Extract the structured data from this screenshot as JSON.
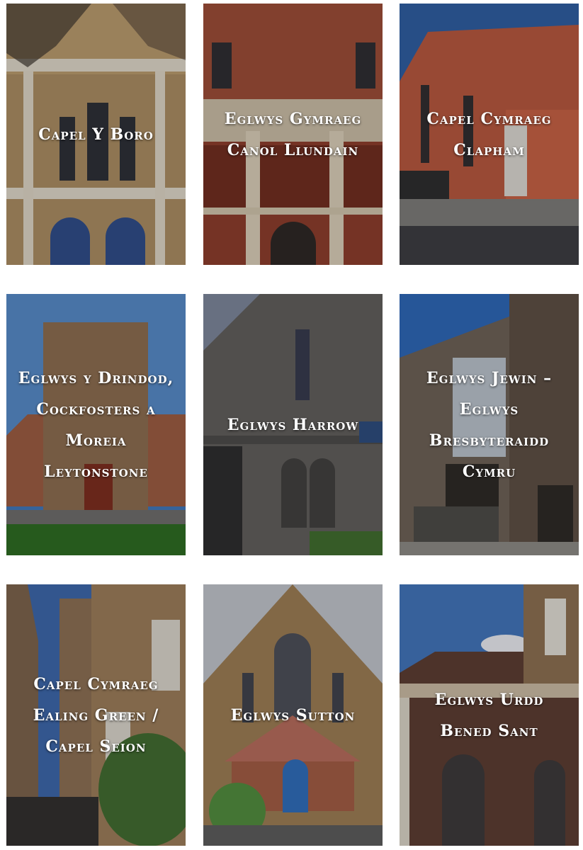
{
  "cards": [
    {
      "title": "Capel Y Boro"
    },
    {
      "title": "Eglwys Gymraeg Canol Llundain"
    },
    {
      "title": "Capel Cymraeg Clapham"
    },
    {
      "title": "Eglwys y Drindod, Cockfosters a Moreia Leytonstone"
    },
    {
      "title": "Eglwys Harrow"
    },
    {
      "title": "Eglwys Jewin – Eglwys Bresbyteraidd Cymru"
    },
    {
      "title": "Capel Cymraeg Ealing Green / Capel Seion"
    },
    {
      "title": "Eglwys Sutton"
    },
    {
      "title": "Eglwys Urdd Bened Sant"
    }
  ]
}
